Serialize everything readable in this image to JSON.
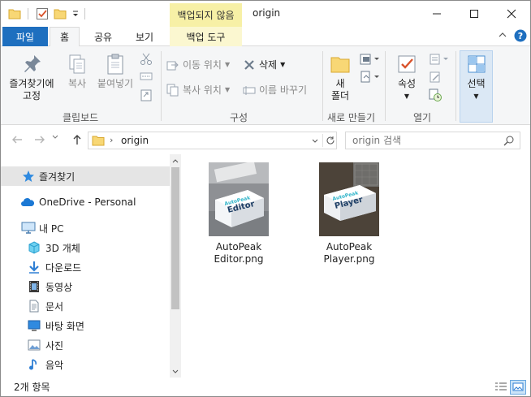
{
  "window": {
    "title": "origin",
    "contextual_tab_title": "백업되지 않음"
  },
  "tabs": {
    "file": "파일",
    "home": "홈",
    "share": "공유",
    "view": "보기",
    "manage": "백업 도구"
  },
  "ribbon": {
    "pin_line1": "즐겨찾기에",
    "pin_line2": "고정",
    "copy": "복사",
    "paste": "붙여넣기",
    "clipboard_group": "클립보드",
    "move_to": "이동 위치",
    "copy_to": "복사 위치",
    "delete": "삭제",
    "rename": "이름 바꾸기",
    "organize_group": "구성",
    "new_folder_line1": "새",
    "new_folder_line2": "폴더",
    "new_group": "새로 만들기",
    "properties": "속성",
    "open_group": "열기",
    "select": "선택"
  },
  "address": {
    "path": "origin",
    "search_placeholder": "origin 검색"
  },
  "nav": {
    "items": [
      {
        "label": "즐겨찾기",
        "icon": "star-icon"
      },
      {
        "label": "OneDrive - Personal",
        "icon": "cloud-icon"
      },
      {
        "label": "내 PC",
        "icon": "computer-icon"
      },
      {
        "label": "3D 개체",
        "icon": "cube-icon"
      },
      {
        "label": "다운로드",
        "icon": "download-icon"
      },
      {
        "label": "동영상",
        "icon": "film-icon"
      },
      {
        "label": "문서",
        "icon": "document-icon"
      },
      {
        "label": "바탕 화면",
        "icon": "desktop-icon"
      },
      {
        "label": "사진",
        "icon": "picture-icon"
      },
      {
        "label": "음악",
        "icon": "music-icon"
      }
    ]
  },
  "files": [
    {
      "name_line1": "AutoPeak",
      "name_line2": "Editor.png",
      "box_title": "Editor",
      "box_brand": "AutoPeak"
    },
    {
      "name_line1": "AutoPeak",
      "name_line2": "Player.png",
      "box_title": "Player",
      "box_brand": "AutoPeak"
    }
  ],
  "status": {
    "item_count": "2개 항목"
  },
  "colors": {
    "accent": "#1e6fbf",
    "contextual_tab": "#f7f0a6",
    "selected_nav": "#e5e5e5"
  }
}
